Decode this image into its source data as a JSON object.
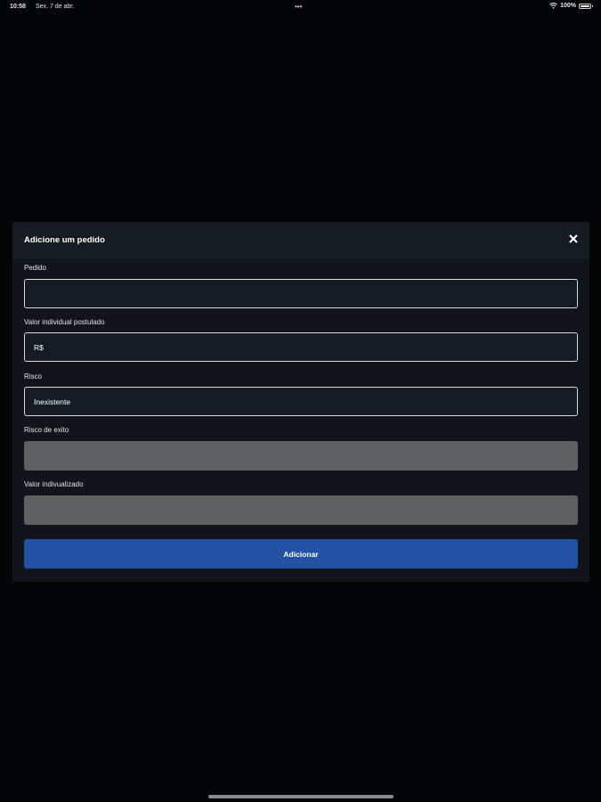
{
  "status_bar": {
    "time": "10:58",
    "date": "Sex. 7 de abr.",
    "dots": "•••",
    "battery": "100%",
    "icons": [
      "wifi-icon",
      "battery-icon"
    ]
  },
  "modal": {
    "title": "Adicione um pedido",
    "close_icon": "close-icon",
    "fields": [
      {
        "label": "Pedido",
        "value": "",
        "state": "editable"
      },
      {
        "label": "Valor individual postulado",
        "value": "R$",
        "state": "editable"
      },
      {
        "label": "Risco",
        "value": "Inexistente",
        "state": "editable"
      },
      {
        "label": "Risco de exito",
        "value": "",
        "state": "disabled"
      },
      {
        "label": "Valor indivualizado",
        "value": "",
        "state": "disabled"
      }
    ],
    "submit_label": "Adicionar"
  },
  "colors": {
    "background": "#040507",
    "modal_background": "#11141a",
    "input_border": "#d8dadd",
    "disabled_input": "#5d6163",
    "primary_button": "#2352a4"
  }
}
